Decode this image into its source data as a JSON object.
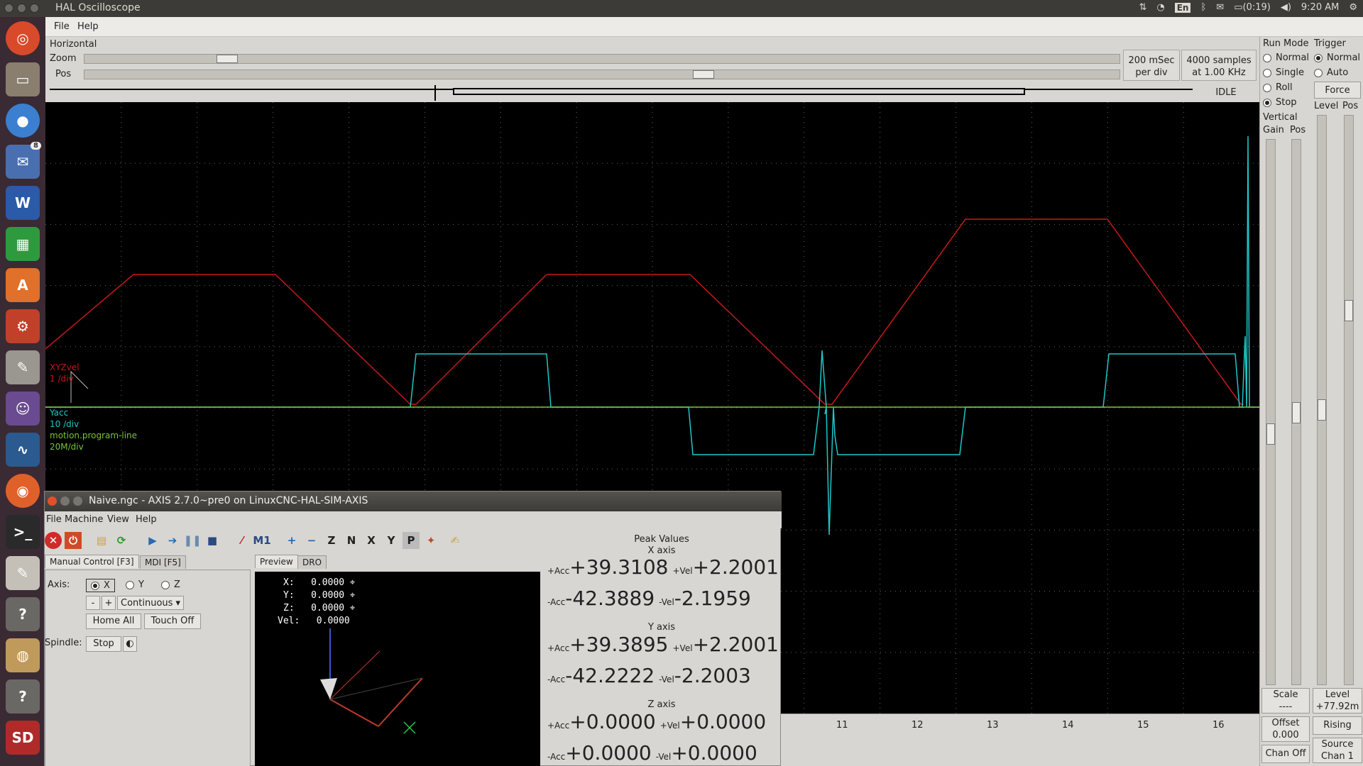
{
  "window_title": "HAL Oscilloscope",
  "tray": {
    "keyboard": "En",
    "battery": "(0:19)",
    "time": "9:20 AM"
  },
  "menu": {
    "file": "File",
    "help": "Help"
  },
  "horizontal": {
    "title": "Horizontal",
    "zoom_label": "Zoom",
    "pos_label": "Pos",
    "zoom_level": 0.13,
    "pos_level": 0.6,
    "rate_line1": "200 mSec",
    "rate_line2": "per div",
    "samples_line1": "4000 samples",
    "samples_line2": "at 1.00 KHz",
    "status": "IDLE"
  },
  "plot": {
    "ch1_name": "XYZvel",
    "ch1_scale": "1 /div",
    "ch2_name": "Yacc",
    "ch2_scale": "10 /div",
    "ch3_name": "motion.program-line",
    "ch3_scale": "20M/div",
    "colors": {
      "ch1": "#c41a1a",
      "ch2": "#1ec8c8",
      "ch3": "#7ac43a",
      "grid": "#666666"
    },
    "div_labels": [
      "11",
      "12",
      "13",
      "14",
      "15",
      "16"
    ]
  },
  "run_mode": {
    "title": "Run Mode",
    "options": [
      "Normal",
      "Single",
      "Roll",
      "Stop"
    ],
    "selected": "Stop"
  },
  "trigger": {
    "title": "Trigger",
    "options": [
      "Normal",
      "Auto"
    ],
    "selected": "Normal",
    "force_label": "Force",
    "level_label": "Level",
    "pos_label": "Pos",
    "level_title": "Level",
    "level_value": "+77.92m",
    "edge": "Rising",
    "source_title": "Source",
    "source_value": "Chan  1"
  },
  "vertical": {
    "title": "Vertical",
    "gain_label": "Gain",
    "pos_label": "Pos",
    "scale_title": "Scale",
    "scale_value": "----",
    "offset_title": "Offset",
    "offset_value": "0.000",
    "chan_off": "Chan Off"
  },
  "axis": {
    "title": "Naive.ngc - AXIS 2.7.0~pre0 on LinuxCNC-HAL-SIM-AXIS",
    "menu": [
      "File",
      "Machine",
      "View",
      "Help"
    ],
    "tabs": [
      "Manual Control [F3]",
      "MDI [F5]"
    ],
    "axis_label": "Axis:",
    "axis_options": [
      "X",
      "Y",
      "Z"
    ],
    "axis_selected": "X",
    "minus": "-",
    "plus": "+",
    "jog_mode": "Continuous",
    "home_all": "Home All",
    "touch_off": "Touch Off",
    "spindle_label": "Spindle:",
    "spindle_stop": "Stop",
    "view_tabs": [
      "Preview",
      "DRO"
    ],
    "dro": {
      "x_label": "X:",
      "x": "0.0000",
      "y_label": "Y:",
      "y": "0.0000",
      "z_label": "Z:",
      "z": "0.0000",
      "vel_label": "Vel:",
      "vel": "0.0000"
    },
    "peak": {
      "title": "Peak Values",
      "x_axis": "X axis",
      "y_axis": "Y axis",
      "z_axis": "Z axis",
      "plus_acc": "+Acc",
      "plus_vel": "+Vel",
      "minus_acc": "-Acc",
      "minus_vel": "-Vel",
      "x_pacc": "+39.3108",
      "x_pvel": "+2.2001",
      "x_nacc": "-42.3889",
      "x_nvel": "-2.1959",
      "y_pacc": "+39.3895",
      "y_pvel": "+2.2001",
      "y_nacc": "-42.2222",
      "y_nvel": "-2.2003",
      "z_pacc": "+0.0000",
      "z_pvel": "+0.0000",
      "z_nacc": "+0.0000",
      "z_nvel": "+0.0000"
    }
  }
}
